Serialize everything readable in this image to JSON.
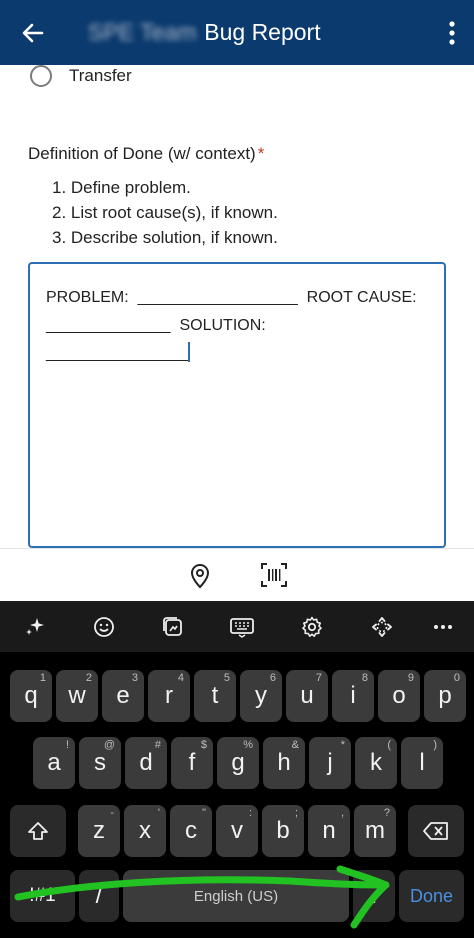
{
  "app_bar": {
    "title_blurred": "SPE Team",
    "title": "Bug Report"
  },
  "form": {
    "radio_option": "Transfer",
    "question": "Definition of Done (w/ context)",
    "required_mark": "*",
    "steps": [
      "1. Define problem.",
      "2. List root cause(s), if known.",
      "3. Describe solution, if known."
    ],
    "answer_text": "PROBLEM:  __________________  ROOT CAUSE:\n______________  SOLUTION:\n________________"
  },
  "keyboard": {
    "tools": [
      "sparkle-icon",
      "emoji-icon",
      "sticker-icon",
      "keyboard-icon",
      "settings-icon",
      "cursor-move-icon",
      "more-icon"
    ],
    "row1": [
      [
        "q",
        "1"
      ],
      [
        "w",
        "2"
      ],
      [
        "e",
        "3"
      ],
      [
        "r",
        "4"
      ],
      [
        "t",
        "5"
      ],
      [
        "y",
        "6"
      ],
      [
        "u",
        "7"
      ],
      [
        "i",
        "8"
      ],
      [
        "o",
        "9"
      ],
      [
        "p",
        "0"
      ]
    ],
    "row2": [
      [
        "a",
        "!"
      ],
      [
        "s",
        "@"
      ],
      [
        "d",
        "#"
      ],
      [
        "f",
        "$"
      ],
      [
        "g",
        "%"
      ],
      [
        "h",
        "&"
      ],
      [
        "j",
        "*"
      ],
      [
        "k",
        "("
      ],
      [
        "l",
        ")"
      ]
    ],
    "row3": [
      [
        "z",
        "-"
      ],
      [
        "x",
        "'"
      ],
      [
        "c",
        "\""
      ],
      [
        "v",
        ":"
      ],
      [
        "b",
        ";"
      ],
      [
        "n",
        ","
      ],
      [
        "m",
        "?"
      ]
    ],
    "symbols_key": "!#1",
    "slash_key": "/",
    "space_label": "English (US)",
    "period_key": ".",
    "done_key": "Done"
  },
  "colors": {
    "app_bar": "#0b3a6e",
    "accent": "#2c6fb5",
    "annotation_arrow": "#22c222"
  }
}
